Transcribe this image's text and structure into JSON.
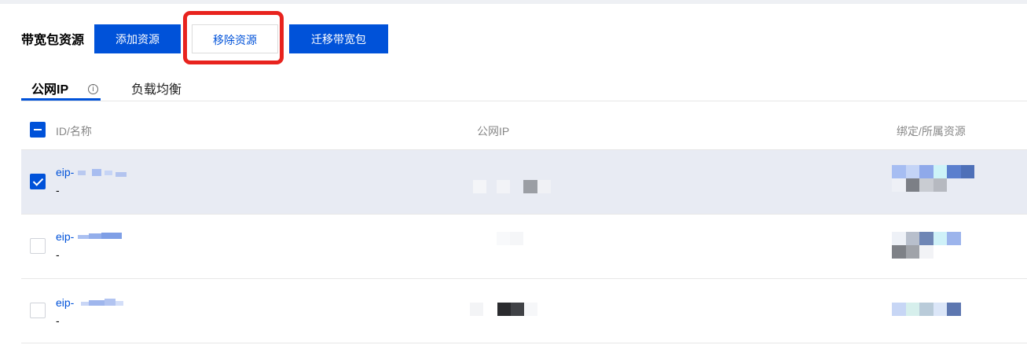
{
  "section": {
    "title": "带宽包资源"
  },
  "toolbar": {
    "add_label": "添加资源",
    "remove_label": "移除资源",
    "migrate_label": "迁移带宽包"
  },
  "tabs": [
    {
      "label": "公网IP",
      "active": true,
      "info_icon": "info-icon"
    },
    {
      "label": "负载均衡",
      "active": false
    }
  ],
  "table": {
    "columns": [
      "ID/名称",
      "公网IP",
      "绑定/所属资源"
    ],
    "header_checkbox": "indeterminate",
    "rows": [
      {
        "selected": true,
        "id_prefix": "eip-",
        "name": "-"
      },
      {
        "selected": false,
        "id_prefix": "eip-",
        "name": "-"
      },
      {
        "selected": false,
        "id_prefix": "eip-",
        "name": "-"
      }
    ]
  },
  "colors": {
    "primary": "#0052d9",
    "highlight": "#e8231e",
    "selected_row_bg": "#e8ebf3"
  },
  "icons": [
    "info-icon",
    "checkbox-indeterminate-icon",
    "checkbox-checked-icon"
  ]
}
